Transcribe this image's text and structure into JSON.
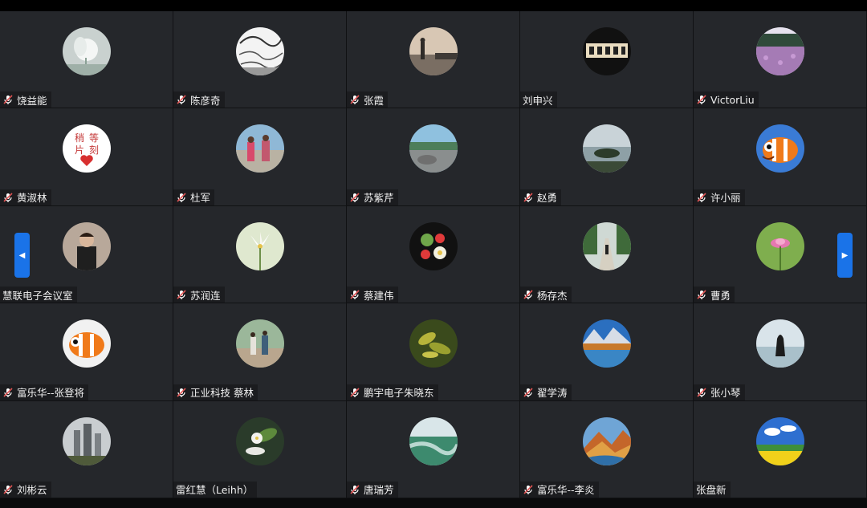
{
  "participants": [
    {
      "name": "饶益能",
      "mic": true,
      "avatar": "white-flower-photo"
    },
    {
      "name": "陈彦奇",
      "mic": true,
      "avatar": "sketch-drawing"
    },
    {
      "name": "张霞",
      "mic": true,
      "avatar": "person-seaside-photo"
    },
    {
      "name": "刘申兴",
      "mic": false,
      "avatar": "calligraphy-plaque"
    },
    {
      "name": "VictorLiu",
      "mic": true,
      "avatar": "purple-flower-field-photo"
    },
    {
      "name": "黄淑林",
      "mic": true,
      "avatar": "please-wait-heart-card",
      "avatar_text": [
        "稍",
        "等",
        "片",
        "刻"
      ]
    },
    {
      "name": "杜军",
      "mic": true,
      "avatar": "children-photo"
    },
    {
      "name": "苏紫芹",
      "mic": true,
      "avatar": "lake-rocks-photo"
    },
    {
      "name": "赵勇",
      "mic": true,
      "avatar": "island-sea-photo"
    },
    {
      "name": "许小丽",
      "mic": true,
      "avatar": "clownfish-cartoon"
    },
    {
      "name": "慧联电子会议室",
      "mic": false,
      "avatar": "person-portrait-photo"
    },
    {
      "name": "苏润连",
      "mic": true,
      "avatar": "white-lily-photo"
    },
    {
      "name": "蔡建伟",
      "mic": true,
      "avatar": "flowers-bowl-photo"
    },
    {
      "name": "杨存杰",
      "mic": true,
      "avatar": "person-on-path-photo"
    },
    {
      "name": "曹勇",
      "mic": true,
      "avatar": "pink-lotus-photo"
    },
    {
      "name": "富乐华--张登将",
      "mic": true,
      "avatar": "clownfish-cartoon"
    },
    {
      "name": "正业科技 蔡林",
      "mic": true,
      "avatar": "garden-people-photo"
    },
    {
      "name": "鹏宇电子朱晓东",
      "mic": true,
      "avatar": "green-leaves-photo"
    },
    {
      "name": "翟学涛",
      "mic": true,
      "avatar": "mountain-lake-photo"
    },
    {
      "name": "张小琴",
      "mic": true,
      "avatar": "woman-by-lake-photo"
    },
    {
      "name": "刘彬云",
      "mic": true,
      "avatar": "city-skyline-photo"
    },
    {
      "name": "雷红慧（Leihh）",
      "mic": false,
      "avatar": "white-flower-leaves-photo"
    },
    {
      "name": "唐瑞芳",
      "mic": true,
      "avatar": "green-river-photo"
    },
    {
      "name": "富乐华--李炎",
      "mic": true,
      "avatar": "autumn-mountain-photo"
    },
    {
      "name": "张盘新",
      "mic": false,
      "avatar": "canola-field-photo"
    }
  ],
  "navigation": {
    "prev_icon": "◀",
    "next_icon": "▶"
  },
  "colors": {
    "tile_bg": "#25272b",
    "name_bg": "#1b1c1f",
    "nav_button": "#1a73e8",
    "mic_icon": "#e05555"
  }
}
